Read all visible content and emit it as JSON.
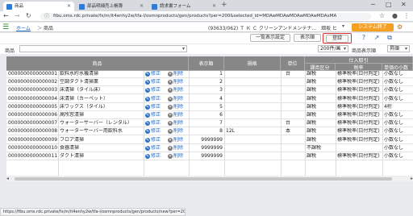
{
  "browser": {
    "tabs": [
      {
        "title": "商品",
        "active": true
      },
      {
        "title": "部品明細売上帳簿",
        "active": false
      },
      {
        "title": "請求書フォーム",
        "active": false
      }
    ],
    "newtab": "+",
    "url": "fibu.oms.rdc.private/fx/m/it4enhy2w/tfa-l/osmnproducts/gen/products?per=200&selected_id=MDAwMDAwMDAwMDAwMDAxMA",
    "status_url": "https://fibu.oms.rdc.private/fx/m/it4enhy2w/tfa-l/osmnproducts/gen/products/new?per=200"
  },
  "header": {
    "breadcrumb_home": "ホーム",
    "breadcrumb_sep": "＞",
    "breadcrumb_current": "商品",
    "company": "(93633/062) Ｔ Ｋ Ｃ クリーンアンドメンテナ…",
    "user": "畑坂 ヒ",
    "system_end": "システム終了",
    "accent": "#f6a023"
  },
  "toolbar": {
    "list_display_setting": "一覧表示設定",
    "display_order": "表示順",
    "register": "登録"
  },
  "filter": {
    "label": "商品",
    "value": "",
    "per_page": "200件/画",
    "sort_label": "商品表示順",
    "sort_value": "昇順"
  },
  "table": {
    "headers": {
      "product": "商品",
      "display_order": "表示順",
      "spec": "規格",
      "unit": "単位",
      "sales_entry": "仕入取引",
      "tax_class": "課否区分",
      "tax_rate": "税率",
      "unit_price_rounding": "単価の小数"
    },
    "edit_label": "修正",
    "delete_label": "削除",
    "rows": [
      {
        "code": "0000000000000001",
        "name": "飲料水貯水機清掃",
        "order": "1",
        "spec": "",
        "unit": "台",
        "tax": "課税",
        "rate": "標準税率(日付判定)",
        "dec": "小数なし"
      },
      {
        "code": "0000000000000002",
        "name": "空調ダクト清掃業",
        "order": "2",
        "spec": "",
        "unit": "",
        "tax": "課税",
        "rate": "標準税率(日付判定)",
        "dec": "小数なし"
      },
      {
        "code": "0000000000000003",
        "name": "床清掃（タイル床）",
        "order": "3",
        "spec": "",
        "unit": "",
        "tax": "課税",
        "rate": "標準税率(日付判定)",
        "dec": "小数なし"
      },
      {
        "code": "0000000000000004",
        "name": "床清掃（カーペット）",
        "order": "4",
        "spec": "",
        "unit": "",
        "tax": "課税",
        "rate": "標準税率(日付判定)",
        "dec": "小数なし"
      },
      {
        "code": "0000000000000005",
        "name": "床ワックス（タイル）",
        "order": "5",
        "spec": "",
        "unit": "",
        "tax": "課税",
        "rate": "標準税率(日付判定)",
        "dec": "4桁"
      },
      {
        "code": "0000000000000006",
        "name": "高所窓清掃",
        "order": "6",
        "spec": "",
        "unit": "",
        "tax": "課税",
        "rate": "標準税率(日付判定)",
        "dec": "小数なし"
      },
      {
        "code": "0000000000000007",
        "name": "ウォーターサーバー（レンタル）",
        "order": "7",
        "spec": "",
        "unit": "台",
        "tax": "課税",
        "rate": "標準税率(日付判定)",
        "dec": "小数なし"
      },
      {
        "code": "0000000000000008",
        "name": "ウォーターサーバー用飲料水",
        "order": "8",
        "spec": "12L",
        "unit": "本",
        "tax": "課税",
        "rate": "標準税率(日付判定)",
        "dec": "小数なし"
      },
      {
        "code": "0000000000000009",
        "name": "フロア清掃",
        "order": "9999999",
        "spec": "",
        "unit": "",
        "tax": "課税",
        "rate": "標準税率(日付判定)",
        "dec": "小数なし"
      },
      {
        "code": "0000000000000010",
        "name": "食器清掃",
        "order": "9999999",
        "spec": "",
        "unit": "",
        "tax": "不課税",
        "rate": "",
        "dec": "小数なし"
      },
      {
        "code": "0000000000000011",
        "name": "ダクト清掃",
        "order": "9999999",
        "spec": "",
        "unit": "",
        "tax": "課税",
        "rate": "標準税率(日付判定)",
        "dec": "小数なし"
      }
    ]
  }
}
